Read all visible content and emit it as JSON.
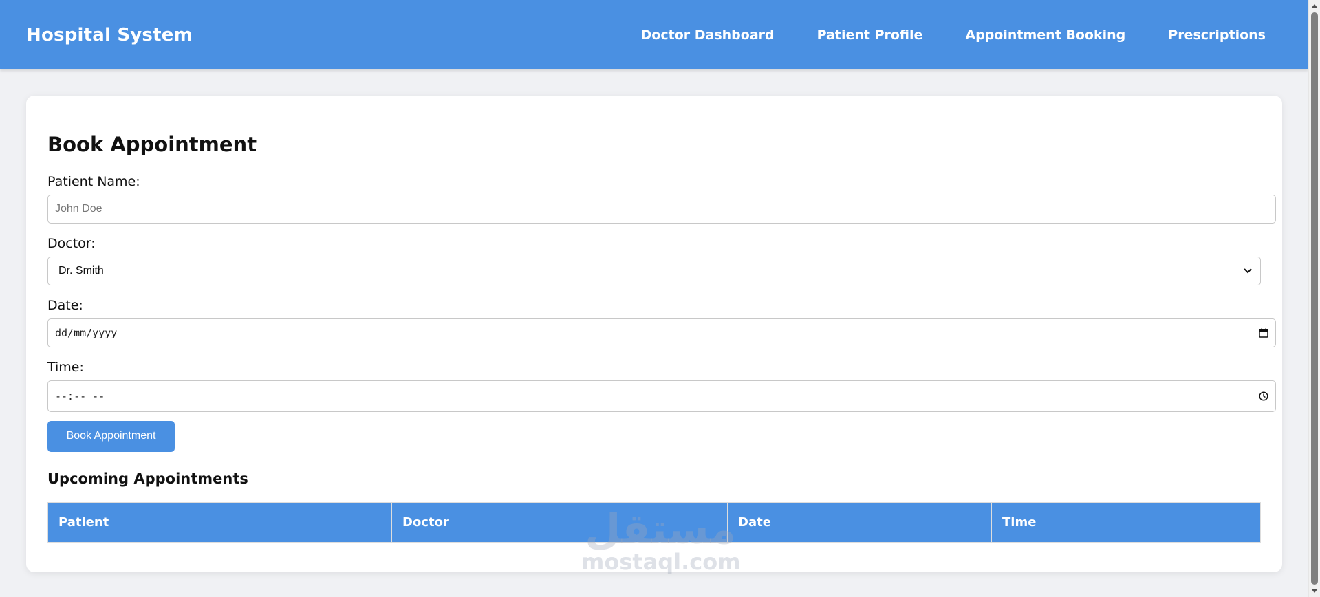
{
  "header": {
    "brand": "Hospital System",
    "nav": [
      {
        "label": "Doctor Dashboard"
      },
      {
        "label": "Patient Profile"
      },
      {
        "label": "Appointment Booking"
      },
      {
        "label": "Prescriptions"
      }
    ]
  },
  "form": {
    "title": "Book Appointment",
    "patient_label": "Patient Name:",
    "patient_placeholder": "John Doe",
    "doctor_label": "Doctor:",
    "doctor_selected": "Dr. Smith",
    "date_label": "Date:",
    "date_value": "dd/mm/yyyy",
    "time_label": "Time:",
    "time_value": "--:-- --",
    "submit_label": "Book Appointment"
  },
  "appointments": {
    "title": "Upcoming Appointments",
    "columns": [
      "Patient",
      "Doctor",
      "Date",
      "Time"
    ]
  },
  "watermark": {
    "arabic": "مستقل",
    "latin": "mostaql.com"
  },
  "colors": {
    "primary": "#4a90e2",
    "background": "#f0f1f4",
    "card": "#ffffff"
  },
  "icons": {
    "select": "chevron-down-icon",
    "date": "calendar-icon",
    "time": "clock-icon"
  }
}
